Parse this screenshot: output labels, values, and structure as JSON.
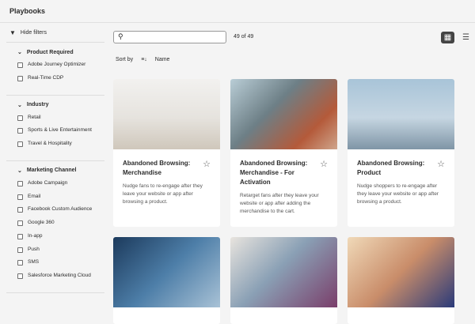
{
  "header": {
    "title": "Playbooks"
  },
  "sidebar": {
    "hide_filters": "Hide filters",
    "groups": [
      {
        "title": "Product Required",
        "options": [
          "Adobe Journey Optimizer",
          "Real-Time CDP"
        ]
      },
      {
        "title": "Industry",
        "options": [
          "Retail",
          "Sports & Live Entertainment",
          "Travel & Hospitality"
        ]
      },
      {
        "title": "Marketing Channel",
        "options": [
          "Adobe Campaign",
          "Email",
          "Facebook Custom Audience",
          "Google 360",
          "In-app",
          "Push",
          "SMS",
          "Salesforce Marketing Cloud"
        ]
      }
    ]
  },
  "toolbar": {
    "search_placeholder": "",
    "count": "49 of 49",
    "sort_label": "Sort by",
    "sort_value": "Name"
  },
  "cards": [
    {
      "title": "Abandoned Browsing: Merchandise",
      "desc": "Nudge fans to re-engage after they leave your website or app after browsing a product."
    },
    {
      "title": "Abandoned Browsing: Merchandise - For Activation",
      "desc": "Retarget fans after they leave your website or app after adding the merchandise to the cart."
    },
    {
      "title": "Abandoned Browsing: Product",
      "desc": "Nudge shoppers to re-engage after they leave your website or app after browsing a product."
    },
    {
      "title": "",
      "desc": ""
    },
    {
      "title": "",
      "desc": ""
    },
    {
      "title": "",
      "desc": ""
    }
  ]
}
